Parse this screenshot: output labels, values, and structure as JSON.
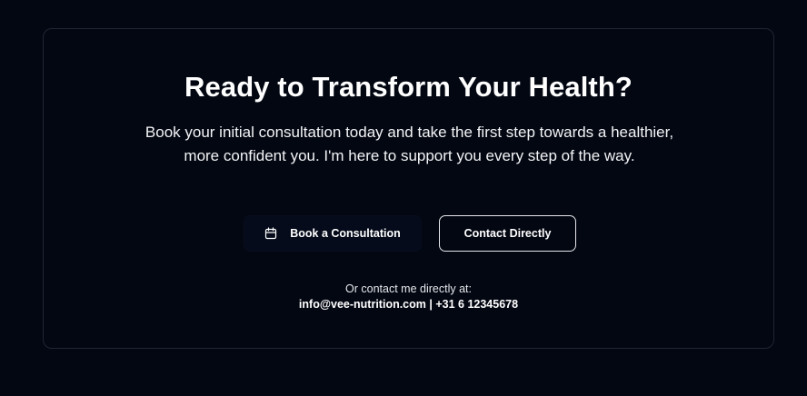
{
  "cta": {
    "title": "Ready to Transform Your Health?",
    "description": "Book your initial consultation today and take the first step towards a healthier, more confident you. I'm here to support you every step of the way.",
    "book_button_label": "Book a Consultation",
    "contact_button_label": "Contact Directly",
    "contact_note": "Or contact me directly at:",
    "email": "info@vee-nutrition.com",
    "separator": " | ",
    "phone": "+31 6 12345678"
  },
  "icons": {
    "book_icon": "calendar-icon"
  },
  "colors": {
    "background": "#030712",
    "card_border": "#1e2533",
    "text": "#ffffff",
    "button_border": "#e5e7eb"
  }
}
